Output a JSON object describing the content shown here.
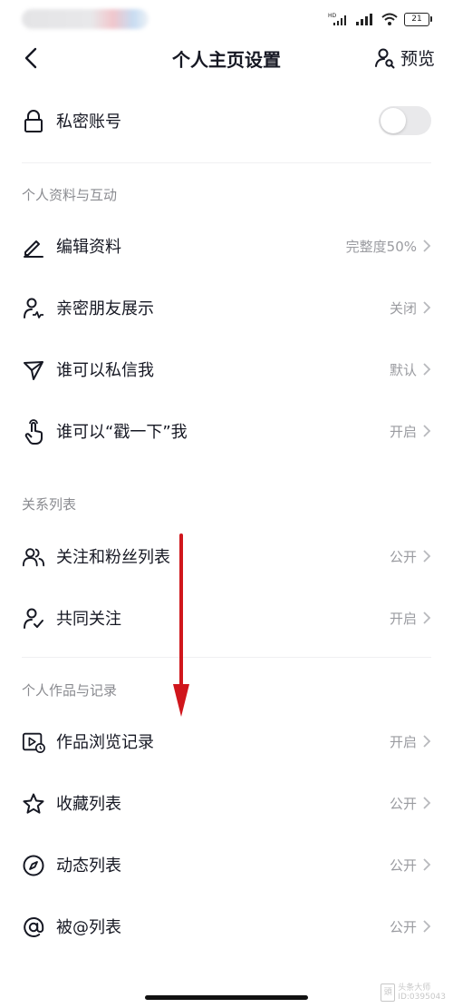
{
  "status_bar": {
    "network_label": "HD",
    "battery": "21"
  },
  "header": {
    "title": "个人主页设置",
    "preview_label": "预览"
  },
  "private_account": {
    "label": "私密账号",
    "enabled": false
  },
  "sections": {
    "profile_interaction": {
      "title": "个人资料与互动",
      "items": [
        {
          "label": "编辑资料",
          "value": "完整度50%",
          "icon": "edit-icon"
        },
        {
          "label": "亲密朋友展示",
          "value": "关闭",
          "icon": "user-heart-icon"
        },
        {
          "label": "谁可以私信我",
          "value": "默认",
          "icon": "send-icon"
        },
        {
          "label": "谁可以“戳一下”我",
          "value": "开启",
          "icon": "tap-hand-icon"
        }
      ]
    },
    "relations": {
      "title": "关系列表",
      "items": [
        {
          "label": "关注和粉丝列表",
          "value": "公开",
          "icon": "users-icon"
        },
        {
          "label": "共同关注",
          "value": "开启",
          "icon": "user-check-icon"
        }
      ]
    },
    "works_records": {
      "title": "个人作品与记录",
      "items": [
        {
          "label": "作品浏览记录",
          "value": "开启",
          "icon": "video-history-icon"
        },
        {
          "label": "收藏列表",
          "value": "公开",
          "icon": "star-icon"
        },
        {
          "label": "动态列表",
          "value": "公开",
          "icon": "compass-icon"
        },
        {
          "label": "被@列表",
          "value": "公开",
          "icon": "at-icon"
        }
      ]
    }
  },
  "watermark": {
    "line1": "头条大师",
    "line2": "ID:0395043"
  },
  "colors": {
    "text_primary": "#161823",
    "text_secondary": "#9a9ba0",
    "annotation_arrow": "#d0161c",
    "toggle_off": "#e9e9eb"
  }
}
